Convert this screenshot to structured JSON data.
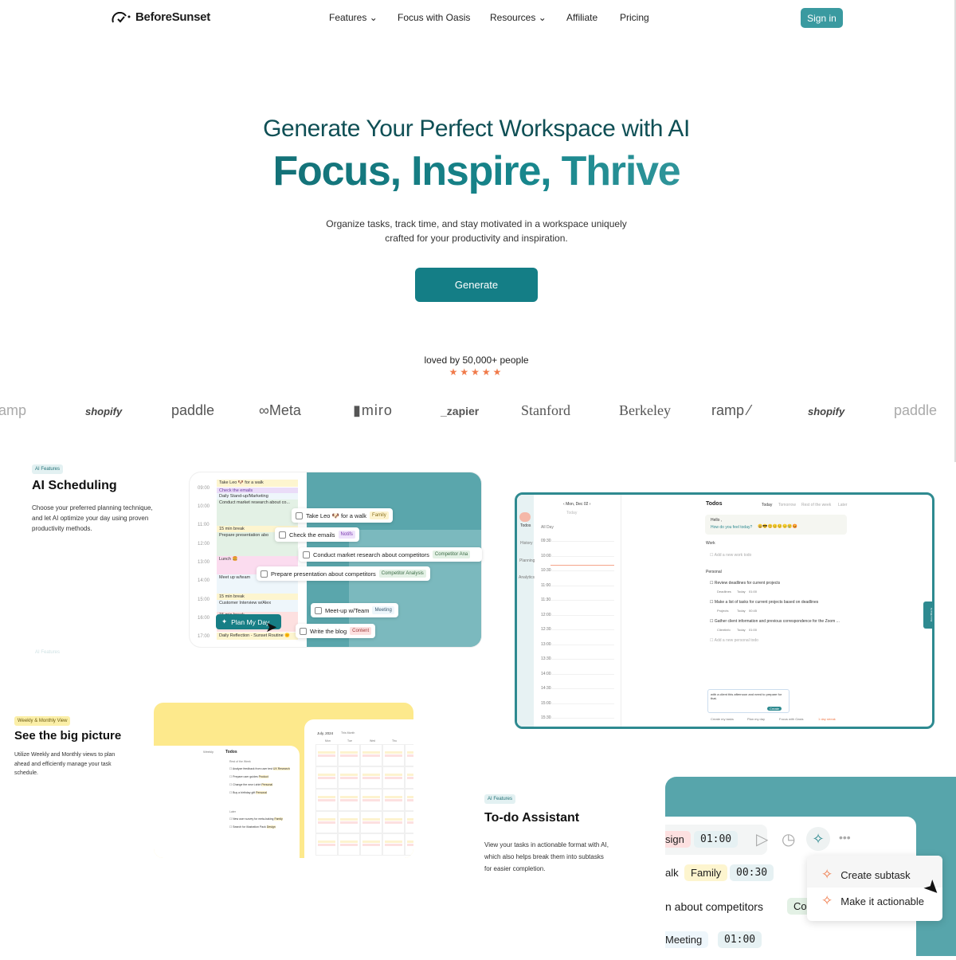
{
  "header": {
    "brand": "BeforeSunset",
    "nav": [
      "Features",
      "Focus with Oasis",
      "Resources",
      "Affiliate",
      "Pricing"
    ],
    "signin": "Sign in"
  },
  "hero": {
    "subtitle": "Generate Your Perfect Workspace with AI",
    "title": "Focus, Inspire, Thrive",
    "desc_line1": "Organize tasks, track time, and stay motivated in a workspace uniquely",
    "desc_line2": "crafted for your productivity and inspiration.",
    "cta": "Generate",
    "loved": "loved by 50,000+ people",
    "stars": "★★★★★",
    "rating": 5
  },
  "logos": [
    "amp",
    "shopify",
    "paddle",
    "Meta",
    "miro",
    "_zapier",
    "Stanford",
    "Berkeley",
    "ramp",
    "shopify",
    "paddle"
  ],
  "colors": {
    "teal": "#147e86",
    "heading": "#0f4f55",
    "star": "#f07a4a",
    "yellow": "#fde98c"
  },
  "features": [
    {
      "badge": "AI Features",
      "title": "AI Scheduling",
      "text_lines": [
        "Choose your preferred planning technique,",
        "and let AI optimize your day using proven",
        "productivity methods."
      ],
      "ghost_badge": "AI Features"
    },
    {
      "badge": "Weekly & Monthly View",
      "title": "See the big picture",
      "text_lines": [
        "Utilize Weekly and Monthly views to plan",
        "ahead and efficiently manage your task",
        "schedule."
      ]
    },
    {
      "badge": "AI Features",
      "title": "To-do Assistant",
      "text_lines": [
        "View your tasks in actionable format with AI,",
        "which also helps break them into subtasks",
        "for easier completion."
      ]
    }
  ],
  "scheduler": {
    "hours": [
      "09:00",
      "10:00",
      "11:00",
      "12:00",
      "13:00",
      "14:00",
      "15:00",
      "16:00",
      "17:00"
    ],
    "events": [
      "Take Leo 🐶 for a walk",
      "Check the emails",
      "Daily Stand-up/Marketing",
      "Conduct market research about co...",
      "15 min break",
      "Prepare presentation abo",
      "Lunch 🍔",
      "Meet up w/team",
      "15 min break",
      "Customer Interview w/Alex",
      "15 min break",
      "Daily Reflection - Sunset Routine 🌞"
    ],
    "chips": [
      {
        "text": "Take Leo 🐶 for a walk",
        "tag": "Family"
      },
      {
        "text": "Check the emails",
        "tag": "Notifs"
      },
      {
        "text": "Conduct market research about competitors",
        "tag": "Competitor Ana"
      },
      {
        "text": "Prepare presentation about competitors",
        "tag": "Competitor Analysis"
      },
      {
        "text": "Meet-up w/Team",
        "tag": "Meeting"
      },
      {
        "text": "Write the blog",
        "tag": "Content"
      }
    ],
    "plan_button": "Plan My Day"
  },
  "app": {
    "date": "Mon, Dec 02",
    "today": "Today",
    "allday": "All Day",
    "side": [
      "Todos",
      "History",
      "Planning",
      "Analytics"
    ],
    "times": [
      "09:30",
      "10:00",
      "10:30",
      "11:00",
      "11:30",
      "12:00",
      "12:30",
      "13:00",
      "13:30",
      "14:00",
      "14:30",
      "15:00",
      "15:30"
    ],
    "todos_title": "Todos",
    "tabs": [
      "Today",
      "Tomorrow",
      "Rest of the week",
      "Later"
    ],
    "hello": "Hello ,",
    "feel": "How do you feel today?",
    "emojis": "😀😎😊😐😟😔😢😡",
    "work": "Work",
    "add_work": "Add a new work todo",
    "personal": "Personal",
    "items": [
      {
        "text": "Review deadlines for current projects",
        "tags": [
          "Deadlines",
          "Today",
          "01:00"
        ]
      },
      {
        "text": "Make a list of tasks for current projects based on deadlines",
        "tags": [
          "Projects",
          "Today",
          "00:45"
        ]
      },
      {
        "text": "Gather client information and previous correspondence for the Zoom ...",
        "tags": [
          "Clientinfo",
          "Today",
          "01:00"
        ]
      }
    ],
    "add_personal": "Add a new personal todo",
    "prompt": "with a client this afternoon and need to prepare for that.",
    "create": "Create",
    "footer": [
      "Create my tasks",
      "Plan my day",
      "Focus with Oasis",
      "1 day streak"
    ],
    "feedback": "Feedback"
  },
  "bigpicture": {
    "view": "Weekly",
    "todos": "Todos",
    "rest": "Rest of the Week",
    "later": "Later",
    "todo_items": [
      {
        "text": "Analyze feedback from user test",
        "tag": "UX Research"
      },
      {
        "text": "Prepare user guides",
        "tag": "Product"
      },
      {
        "text": "Change the new t-shirt",
        "tag": "Personal"
      },
      {
        "text": "Buy a birthday gift",
        "tag": "Personal"
      }
    ],
    "later_items": [
      {
        "text": "New user survey for meta-baking",
        "tag": "Family"
      },
      {
        "text": "Search for illustration Pack",
        "tag": "Design"
      }
    ],
    "add": "Add a new to-do...",
    "month": "July, 2024",
    "this_month": "This Month",
    "days": [
      "Mon",
      "Tue",
      "Wed",
      "Thu"
    ]
  },
  "assistant": {
    "rows": [
      {
        "text": "sign",
        "time": "01:00"
      },
      {
        "text": "alk",
        "tag": "Family",
        "time": "00:30"
      },
      {
        "text": "n about competitors",
        "tag": "Co"
      },
      {
        "text": "Meeting",
        "time": "01:00"
      }
    ],
    "menu": [
      "Create subtask",
      "Make it actionable"
    ]
  }
}
